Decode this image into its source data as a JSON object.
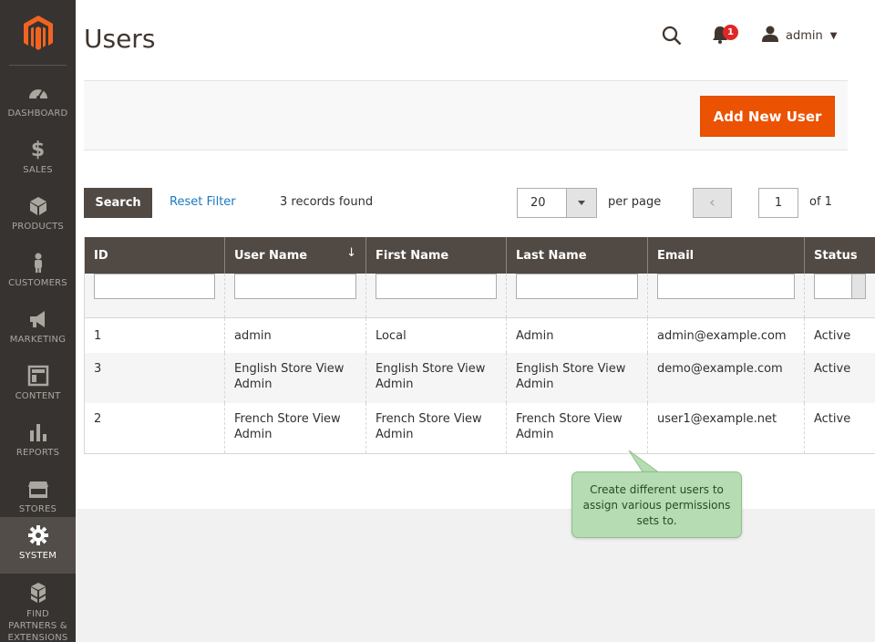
{
  "sidebar": {
    "items": [
      {
        "label": "DASHBOARD",
        "icon": "dashboard-icon"
      },
      {
        "label": "SALES",
        "icon": "dollar-icon"
      },
      {
        "label": "PRODUCTS",
        "icon": "cube-icon"
      },
      {
        "label": "CUSTOMERS",
        "icon": "person-icon"
      },
      {
        "label": "MARKETING",
        "icon": "megaphone-icon"
      },
      {
        "label": "CONTENT",
        "icon": "layout-icon"
      },
      {
        "label": "REPORTS",
        "icon": "bar-chart-icon"
      },
      {
        "label": "STORES",
        "icon": "storefront-icon"
      },
      {
        "label": "SYSTEM",
        "icon": "gear-icon",
        "active": true
      },
      {
        "label": "FIND PARTNERS & EXTENSIONS",
        "icon": "boxes-icon"
      }
    ]
  },
  "header": {
    "title": "Users",
    "notification_count": "1",
    "user_name": "admin"
  },
  "actions": {
    "add_label": "Add New User"
  },
  "grid_controls": {
    "search_label": "Search",
    "reset_label": "Reset Filter",
    "records_text": "3 records found",
    "per_page_value": "20",
    "per_page_label": "per page",
    "current_page": "1",
    "total_pages_label": "of 1"
  },
  "table": {
    "columns": [
      "ID",
      "User Name",
      "First Name",
      "Last Name",
      "Email",
      "Status"
    ],
    "rows": [
      {
        "id": "1",
        "username": "admin",
        "first": "Local",
        "last": "Admin",
        "email": "admin@example.com",
        "status": "Active"
      },
      {
        "id": "3",
        "username": "English Store View Admin",
        "first": "English Store View Admin",
        "last": "English Store View Admin",
        "email": "demo@example.com",
        "status": "Active"
      },
      {
        "id": "2",
        "username": "French Store View Admin",
        "first": "French Store View Admin",
        "last": "French Store View Admin",
        "email": "user1@example.net",
        "status": "Active"
      }
    ]
  },
  "tooltip": {
    "text": "Create different users to assign various permissions sets to."
  },
  "colors": {
    "accent": "#eb5202",
    "sidebar": "#373330",
    "header_row": "#514943",
    "link": "#1979c3",
    "tooltip": "#b5dcb2"
  }
}
